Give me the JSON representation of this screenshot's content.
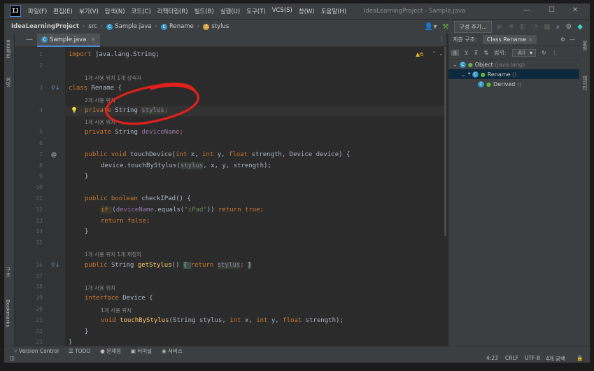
{
  "menu": [
    "파일(F)",
    "편집(E)",
    "보기(V)",
    "탐색(N)",
    "코드(C)",
    "리팩터링(R)",
    "빌드(B)",
    "실행(U)",
    "도구(T)",
    "VCS(S)",
    "창(W)",
    "도움말(H)"
  ],
  "window_title": "IdeaLearningProject - Sample.java",
  "breadcrumb": {
    "project": "IdeaLearningProject",
    "src": "src",
    "file": "Sample.java",
    "cls": "Rename",
    "field": "stylus"
  },
  "run_config": "구성 추가...",
  "editor_tab": "Sample.java",
  "warnings": "▲6",
  "side_tabs": {
    "project": "프로젝트",
    "structure": "구조",
    "bookmarks": "Bookmarks",
    "commit": "커밋"
  },
  "right_tabs": {
    "db": "데이터",
    "notif": "알림"
  },
  "lines": [
    "1",
    "2",
    "3",
    "4",
    "5",
    "6",
    "7",
    "8",
    "9",
    "10",
    "11",
    "12",
    "13",
    "14",
    "15",
    "16",
    "17",
    "18",
    "19",
    "20",
    "21",
    "22",
    "23"
  ],
  "hints": {
    "h1": "1개 사용 위치   1개 상속자",
    "h2": "2개 사용 위치",
    "h3": "1개 사용 위치",
    "h4": "1개 사용 위치   1개 재정의",
    "h5": "1개 사용 위치",
    "h6": "1개 사용 위치"
  },
  "code": {
    "l1_kw": "import ",
    "l1_txt": "java.lang.String;",
    "l3_kw": "class ",
    "l3_txt": "Rename {",
    "l4_kw": "private ",
    "l4_type": "String ",
    "l4_fld": "stylus",
    "l4_end": ";",
    "l5_kw": "private ",
    "l5_type": "String ",
    "l5_fld": "deviceName",
    "l5_end": ";",
    "l7_kw": "public void ",
    "l7_fn": "touchDevice",
    "l7_p1": "(",
    "l7_kw2": "int ",
    "l7_a": "x, ",
    "l7_kw3": "int ",
    "l7_b": "y, ",
    "l7_kw4": "float ",
    "l7_c": "strength, Device device) {",
    "l8_a": "device.touchByStylus(",
    "l8_fld": "stylus",
    "l8_b": ", x, y, strength);",
    "l9": "}",
    "l11_kw": "public boolean ",
    "l11_fn": "checkIPad",
    "l11_b": "() {",
    "l12_kw": "if ",
    "l12_a": "(",
    "l12_fld": "deviceName",
    "l12_b": ".equals(",
    "l12_str": "\"iPad\"",
    "l12_c": ")) ",
    "l12_kw2": "return true",
    ";": ";",
    "l13_kw": "return false",
    "l14": "}",
    "l16_kw": "public ",
    "l16_type": "String ",
    "l16_fn": "getStylus",
    "l16_b": "() ",
    "l16_br1": "{ ",
    "l16_kw2": "return ",
    "l16_fld": "stylus",
    "l16_semi": "; ",
    "l16_br2": "}",
    "l20_kw": "interface ",
    "l20_txt": "Device {",
    "l21_kw": "void ",
    "l21_fn": "touchByStylus",
    "l21_a": "(String stylus, ",
    "l21_kw2": "int ",
    "l21_b": "x, ",
    "l21_kw3": "int ",
    "l21_c": "y, ",
    "l21_kw4": "float ",
    "l21_d": "strength);",
    "l22": "}",
    "l23": "}"
  },
  "hierarchy": {
    "title": "계층 구조:",
    "tab": "Class Rename",
    "scope_label": "범위:",
    "scope_value": "All",
    "items": [
      {
        "name": "Object",
        "pkg": "(java.lang)"
      },
      {
        "name": "Rename",
        "pkg": "()"
      },
      {
        "name": "Derived",
        "pkg": "()"
      }
    ]
  },
  "bottom_tabs": [
    "Version Control",
    "TODO",
    "문제점",
    "터미널",
    "서비스"
  ],
  "status": {
    "pos": "4:23",
    "eol": "CRLF",
    "enc": "UTF-8",
    "indent": "4개 공백"
  },
  "colors": {
    "keyword": "#cc7832",
    "field": "#9876aa",
    "method": "#ffc66d",
    "string": "#6a8759",
    "annotation": "#e0201c"
  }
}
